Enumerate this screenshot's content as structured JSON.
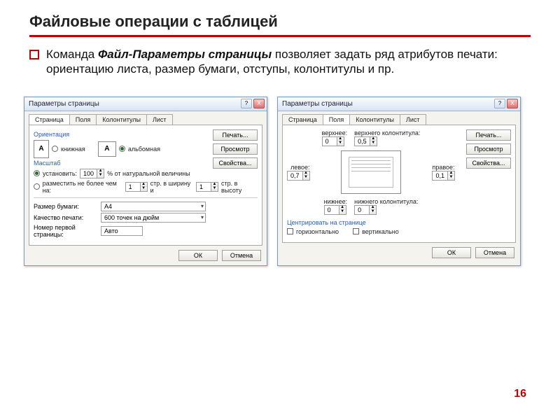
{
  "slide": {
    "title": "Файловые операции с таблицей",
    "body_prefix": "Команда ",
    "body_em": "Файл-Параметры страницы",
    "body_suffix": " позволяет задать ряд атрибутов печати: ориентацию листа, размер бумаги, отступы, колонтитулы и пр.",
    "page_number": "16"
  },
  "dialog_common": {
    "title": "Параметры страницы",
    "help_q": "?",
    "close_x": "X",
    "tabs": {
      "page": "Страница",
      "fields": "Поля",
      "headers": "Колонтитулы",
      "sheet": "Лист"
    },
    "buttons": {
      "print": "Печать...",
      "preview": "Просмотр",
      "props": "Свойства...",
      "ok": "ОК",
      "cancel": "Отмена"
    }
  },
  "dlg1": {
    "orientation": {
      "label": "Ориентация",
      "portrait": "книжная",
      "landscape": "альбомная",
      "icon_letter": "A"
    },
    "scale": {
      "label": "Масштаб",
      "opt_set": "установить:",
      "set_value": "100",
      "set_suffix": "% от натуральной величины",
      "opt_fit": "разместить не более чем на:",
      "fit_w": "1",
      "fit_mid": "стр. в ширину и",
      "fit_h": "1",
      "fit_suffix": "стр. в высоту"
    },
    "paper": {
      "label": "Размер бумаги:",
      "value": "A4"
    },
    "quality": {
      "label": "Качество печати:",
      "value": "600 точек на дюйм"
    },
    "firstpage": {
      "label": "Номер первой страницы:",
      "value": "Авто"
    }
  },
  "dlg2": {
    "top": {
      "label": "верхнее:",
      "value": "0"
    },
    "header": {
      "label": "верхнего колонтитула:",
      "value": "0,5"
    },
    "left": {
      "label": "левое:",
      "value": "0,7"
    },
    "right": {
      "label": "правое:",
      "value": "0,1"
    },
    "bottom": {
      "label": "нижнее:",
      "value": "0"
    },
    "footer": {
      "label": "нижнего колонтитула:",
      "value": "0"
    },
    "center": {
      "label": "Центрировать на странице",
      "horiz": "горизонтально",
      "vert": "вертикально"
    }
  }
}
